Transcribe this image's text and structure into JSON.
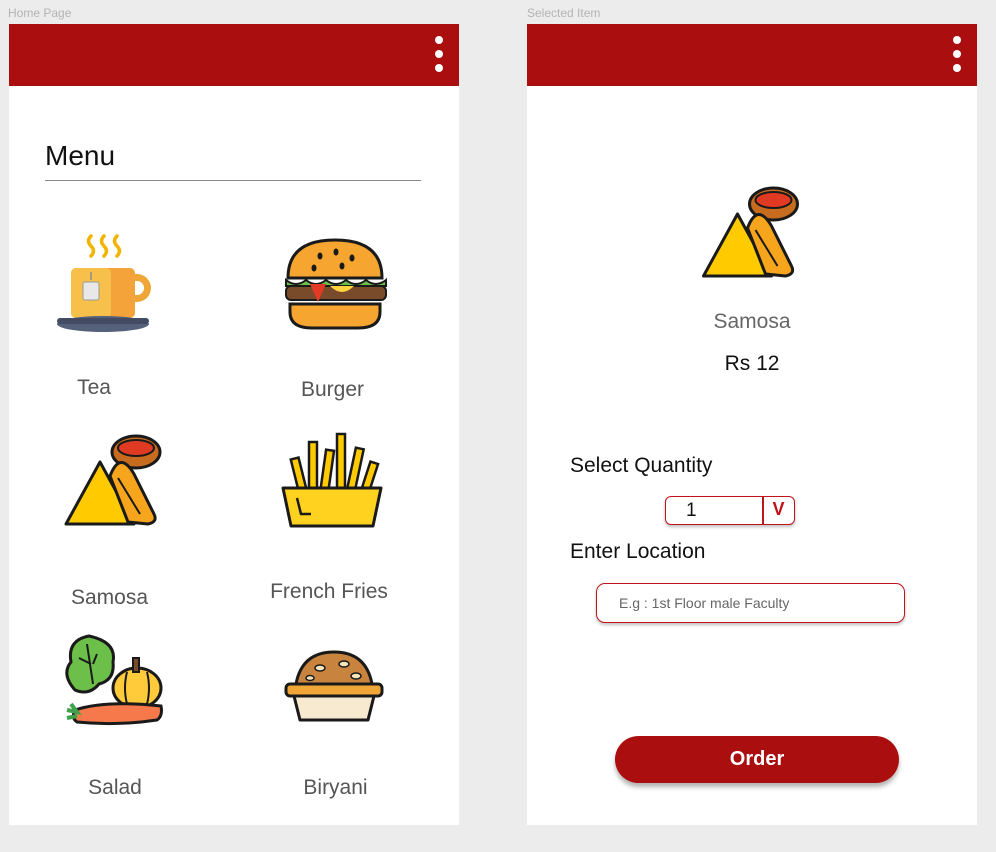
{
  "frames": {
    "home_label": "Home Page",
    "detail_label": "Selected Item"
  },
  "home": {
    "title": "Menu",
    "items": [
      {
        "label": "Tea",
        "icon": "tea-cup-icon"
      },
      {
        "label": "Burger",
        "icon": "burger-icon"
      },
      {
        "label": "Samosa",
        "icon": "samosa-icon"
      },
      {
        "label": "French Fries",
        "icon": "french-fries-icon"
      },
      {
        "label": "Salad",
        "icon": "salad-icon"
      },
      {
        "label": "Biryani",
        "icon": "biryani-icon"
      }
    ]
  },
  "detail": {
    "item_name": "Samosa",
    "price": "Rs 12",
    "quantity_label": "Select Quantity",
    "quantity_value": "1",
    "quantity_chevron": "V",
    "location_label": "Enter Location",
    "location_placeholder": "E.g : 1st Floor male Faculty",
    "order_label": "Order"
  },
  "colors": {
    "brand": "#ab0e0e",
    "accent_border": "#c0141b",
    "background": "#ececec"
  }
}
